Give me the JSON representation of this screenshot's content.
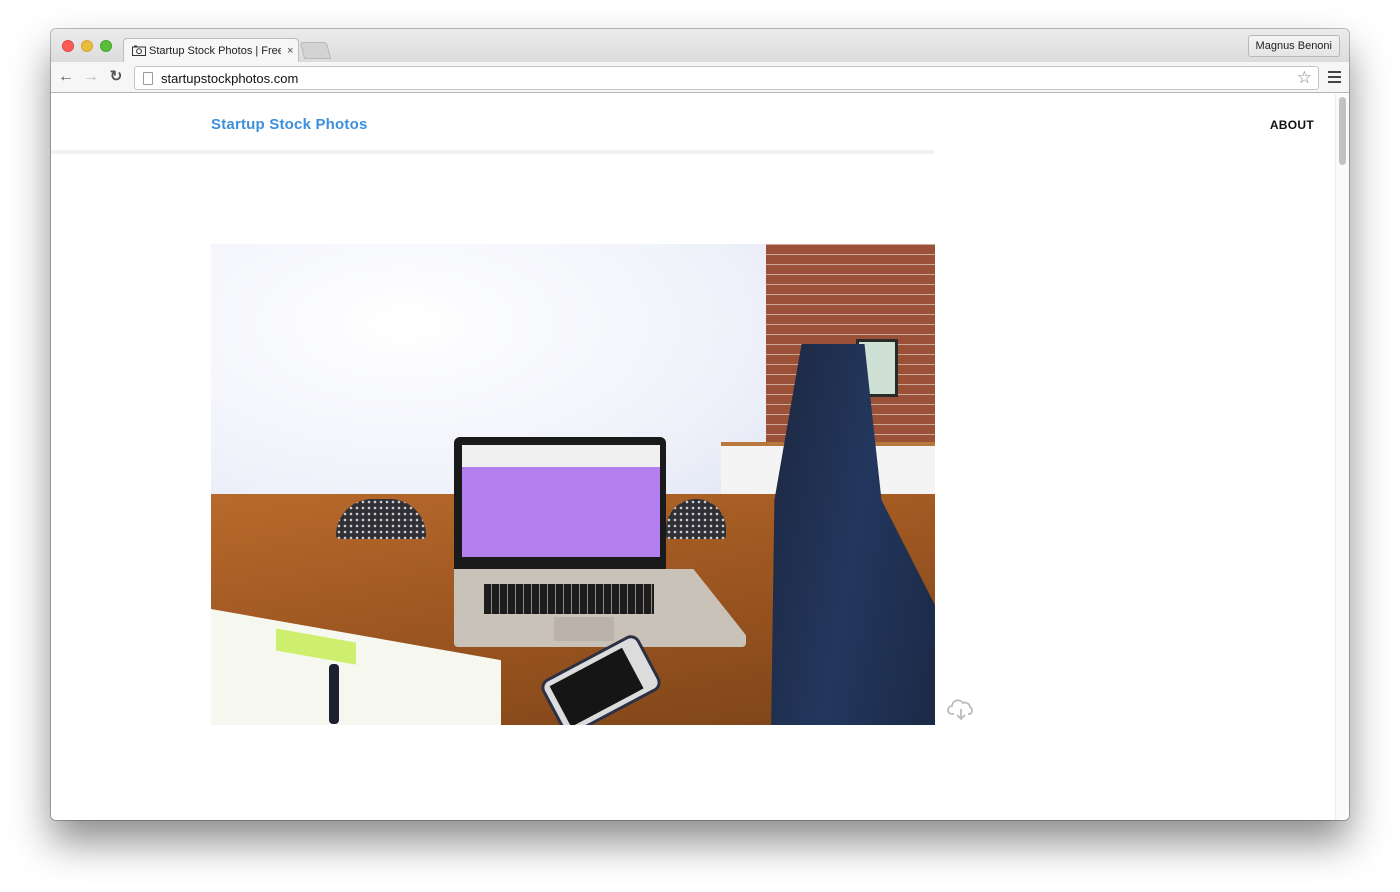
{
  "browser": {
    "tab_title": "Startup Stock Photos | Free",
    "tab_close": "×",
    "profile_name": "Magnus Benoni",
    "url": "startupstockphotos.com",
    "icons": {
      "back": "←",
      "forward": "→",
      "reload": "↻",
      "star": "☆"
    }
  },
  "site": {
    "brand": "Startup Stock Photos",
    "nav": [
      {
        "label": "ABOUT"
      }
    ],
    "brand_color": "#3d8fda"
  },
  "photo": {
    "description": "Laptop on wooden table with feet resting on table in office",
    "download_icon": "cloud-download-icon"
  }
}
